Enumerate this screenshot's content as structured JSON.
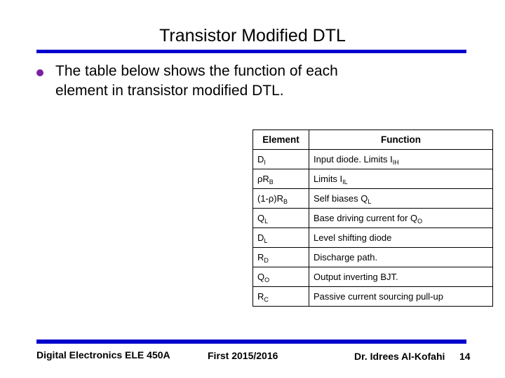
{
  "slide": {
    "title": "Transistor Modified DTL",
    "accent_color": "#0000CC",
    "bullet_color": "#7B1FA2",
    "bullet": {
      "icon": "bullet-dot",
      "line1": "The table below shows the function of each",
      "line2": "element in transistor modified DTL."
    }
  },
  "table": {
    "headers": {
      "element": "Element",
      "function": "Function"
    },
    "rows": [
      {
        "element_base": "D",
        "element_sub": "I",
        "element_tail": "",
        "function_text": "Input diode. Limits I",
        "function_sub": "IH",
        "function_tail": ""
      },
      {
        "element_base": "ρR",
        "element_sub": "B",
        "element_tail": "",
        "function_text": "Limits I",
        "function_sub": "IL",
        "function_tail": ""
      },
      {
        "element_base": "(1-ρ)R",
        "element_sub": "B",
        "element_tail": "",
        "function_text": "Self biases Q",
        "function_sub": "L",
        "function_tail": ""
      },
      {
        "element_base": "Q",
        "element_sub": "L",
        "element_tail": "",
        "function_text": "Base driving current for Q",
        "function_sub": "O",
        "function_tail": ""
      },
      {
        "element_base": "D",
        "element_sub": "L",
        "element_tail": "",
        "function_text": "Level shifting diode",
        "function_sub": "",
        "function_tail": ""
      },
      {
        "element_base": "R",
        "element_sub": "D",
        "element_tail": "",
        "function_text": "Discharge path.",
        "function_sub": "",
        "function_tail": ""
      },
      {
        "element_base": "Q",
        "element_sub": "O",
        "element_tail": "",
        "function_text": "Output inverting BJT.",
        "function_sub": "",
        "function_tail": ""
      },
      {
        "element_base": "R",
        "element_sub": "C",
        "element_tail": "",
        "function_text": "Passive current sourcing pull-up",
        "function_sub": "",
        "function_tail": ""
      }
    ]
  },
  "footer": {
    "course": "Digital Electronics ELE 450A",
    "term": "First 2015/2016",
    "author": "Dr. Idrees Al-Kofahi",
    "page_number": "14"
  }
}
